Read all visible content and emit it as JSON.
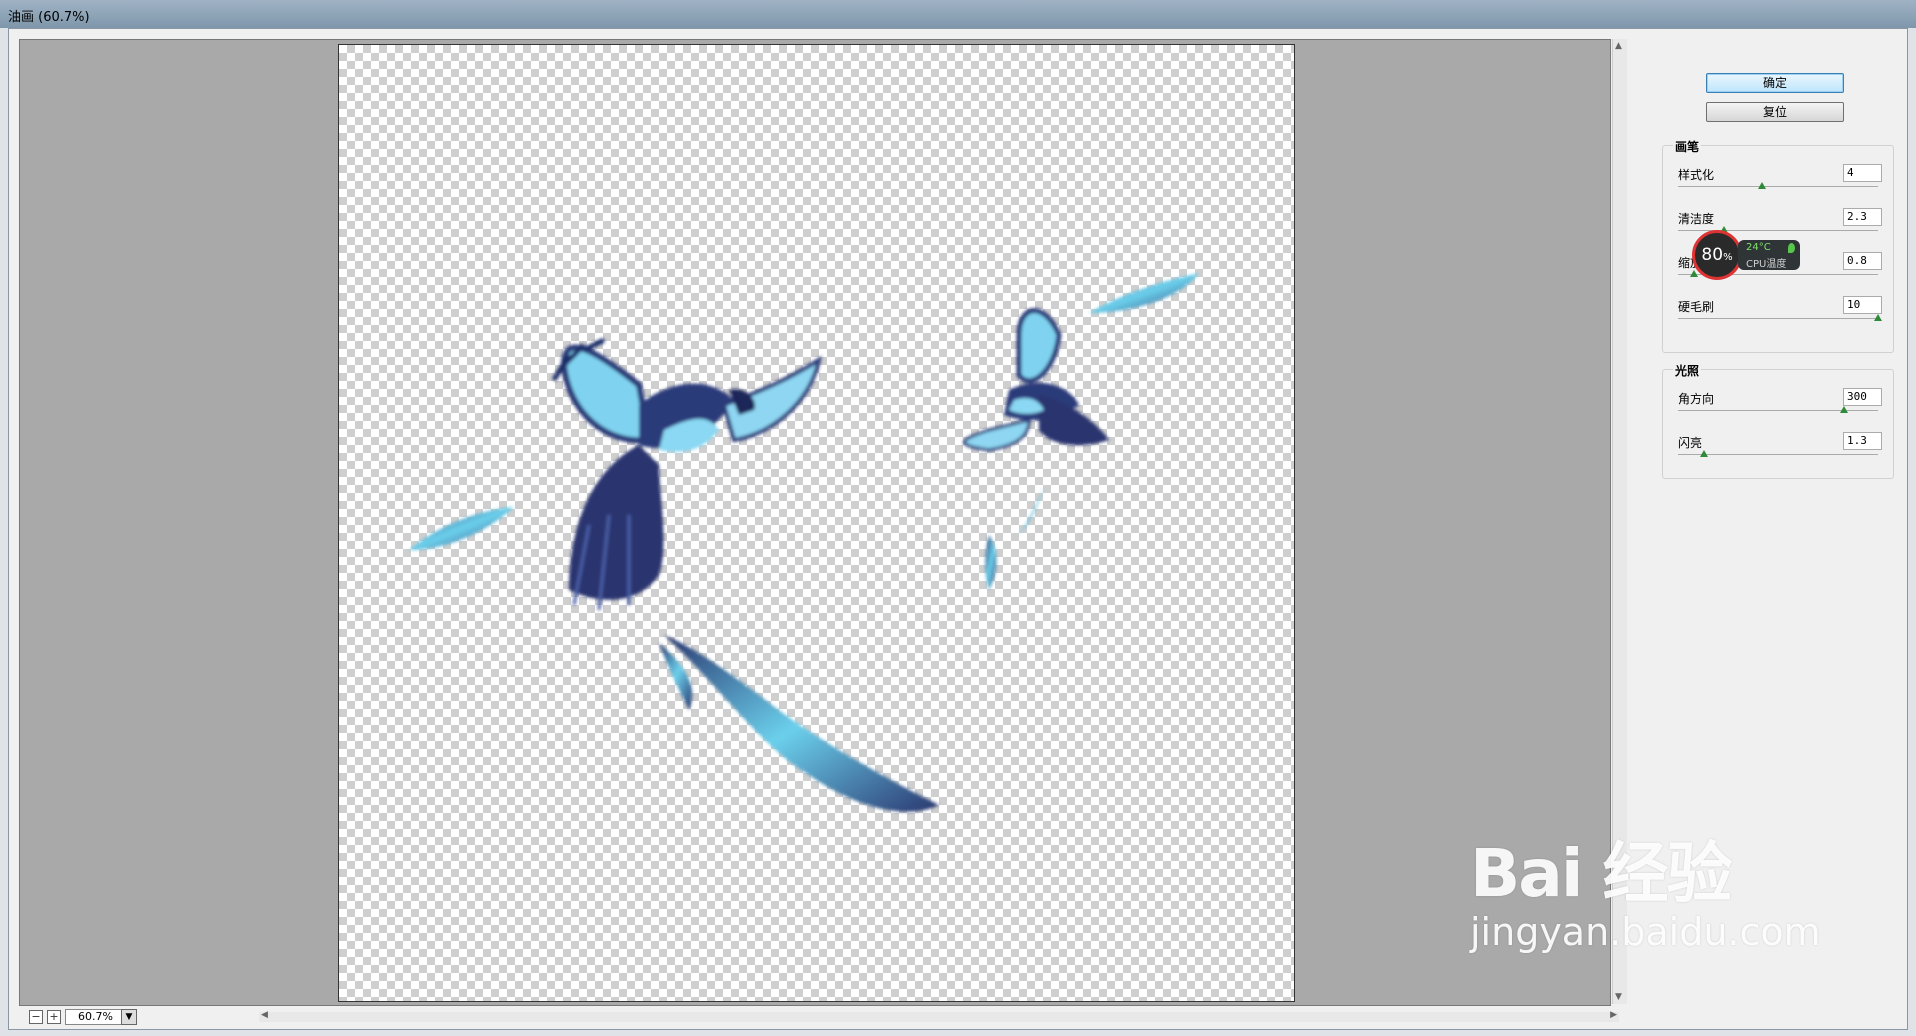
{
  "window": {
    "title": "油画 (60.7%)"
  },
  "toolbar": {
    "ok_label": "确定",
    "reset_label": "复位"
  },
  "brush": {
    "title": "画笔",
    "params": [
      {
        "label": "样式化",
        "value": "4",
        "level": 0.42
      },
      {
        "label": "清洁度",
        "value": "2.3",
        "level": 0.23
      },
      {
        "label": "缩放",
        "value": "0.8",
        "level": 0.08
      },
      {
        "label": "硬毛刷",
        "value": "10",
        "level": 1.0
      }
    ]
  },
  "lighting": {
    "title": "光照",
    "params": [
      {
        "label": "角方向",
        "value": "300",
        "level": 0.83
      },
      {
        "label": "闪亮",
        "value": "1.3",
        "level": 0.13
      }
    ]
  },
  "zoom": {
    "value": "60.7%"
  },
  "cpu": {
    "percent": "80",
    "percent_unit": "%",
    "temp": "24°C",
    "label": "CPU温度"
  },
  "watermark": {
    "brand": "Bai 经验",
    "url": "jingyan.baidu.com"
  }
}
